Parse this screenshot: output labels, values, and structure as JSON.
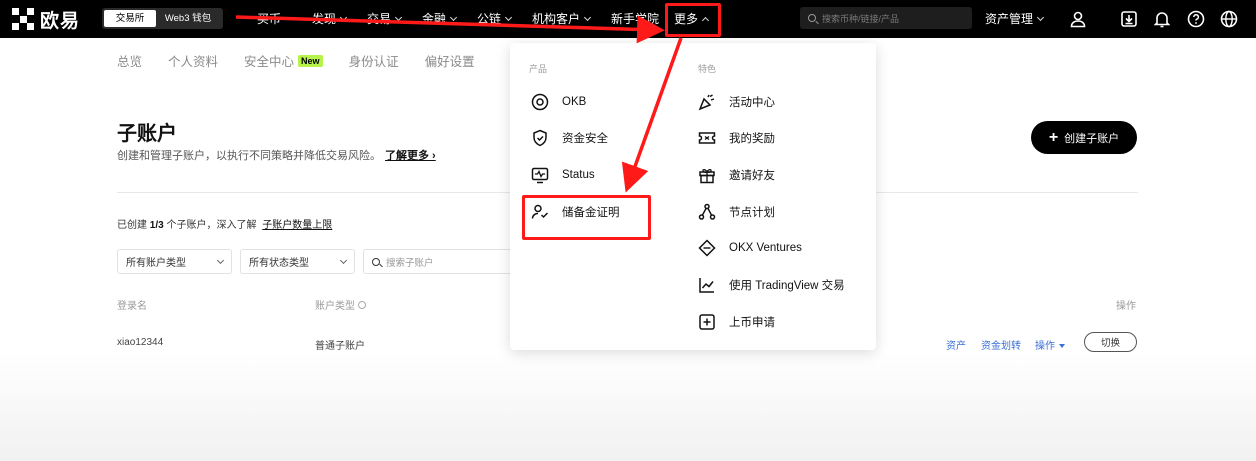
{
  "nav": {
    "logo_text": "欧易",
    "switch": {
      "exchange": "交易所",
      "web3": "Web3 钱包"
    },
    "links": [
      {
        "label": "买币",
        "dropdown": false
      },
      {
        "label": "发现",
        "dropdown": true
      },
      {
        "label": "交易",
        "dropdown": true
      },
      {
        "label": "金融",
        "dropdown": true
      },
      {
        "label": "公链",
        "dropdown": true
      },
      {
        "label": "机构客户",
        "dropdown": true
      },
      {
        "label": "新手学院",
        "dropdown": false
      }
    ],
    "more_label": "更多",
    "search_placeholder": "搜索币种/链接/产品",
    "assets_label": "资产管理"
  },
  "subnav": {
    "items": [
      "总览",
      "个人资料",
      "安全中心",
      "身份认证",
      "偏好设置"
    ],
    "new_badge": "New"
  },
  "page": {
    "title": "子账户",
    "subtitle": "创建和管理子账户，以执行不同策略并降低交易风险。",
    "learn_more": "了解更多 ›",
    "create_button": "创建子账户",
    "created_prefix": "已创建 ",
    "created_count": "1/3",
    "created_suffix": " 个子账户，深入了解 ",
    "created_link": "子账户数量上限",
    "filter_account_type": "所有账户类型",
    "filter_status_type": "所有状态类型",
    "search_placeholder": "搜索子账户",
    "table": {
      "headers": {
        "login": "登录名",
        "account_type": "账户类型",
        "actions": "操作"
      },
      "row": {
        "login": "xiao12344",
        "account_type": "普通子账户",
        "assets": "资产",
        "transfer": "资金划转",
        "operate": "操作",
        "switch": "切换"
      }
    }
  },
  "dropdown": {
    "products_heading": "产品",
    "features_heading": "特色",
    "products": [
      {
        "label": "OKB",
        "icon": "okb-icon"
      },
      {
        "label": "资金安全",
        "icon": "shield-icon"
      },
      {
        "label": "Status",
        "icon": "status-monitor-icon"
      },
      {
        "label": "储备金证明",
        "icon": "user-check-icon"
      }
    ],
    "features": [
      {
        "label": "活动中心",
        "icon": "party-popper-icon"
      },
      {
        "label": "我的奖励",
        "icon": "ticket-icon"
      },
      {
        "label": "邀请好友",
        "icon": "gift-icon"
      },
      {
        "label": "节点计划",
        "icon": "node-network-icon"
      },
      {
        "label": "OKX Ventures",
        "icon": "ventures-icon"
      },
      {
        "label": "使用 TradingView 交易",
        "icon": "chart-line-icon"
      },
      {
        "label": "上币申请",
        "icon": "listing-plus-icon"
      }
    ]
  },
  "colors": {
    "nav_bg": "#000000",
    "annotation_red": "#ff1a1a",
    "new_badge_bg": "#b7f34a",
    "action_link": "#3b6fd6"
  }
}
